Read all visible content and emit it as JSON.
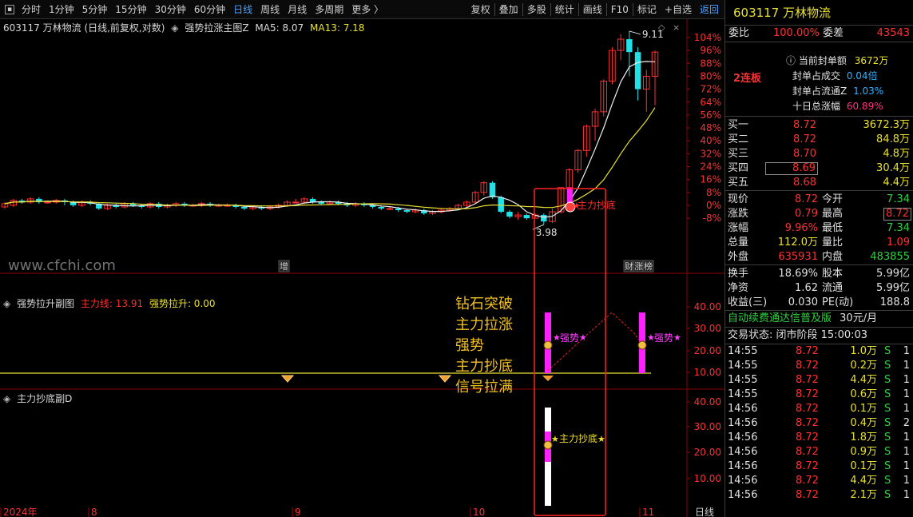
{
  "toolbar": {
    "left_items": [
      "分时",
      "1分钟",
      "5分钟",
      "15分钟",
      "30分钟",
      "60分钟",
      "日线",
      "周线",
      "月线",
      "多周期",
      "更多 〉"
    ],
    "active_index": 6,
    "right_items": [
      "复权",
      "叠加",
      "多股",
      "统计",
      "画线",
      "F10",
      "标记",
      "+自选",
      "返回"
    ]
  },
  "main_info": {
    "title": "603117 万林物流 (日线,前复权,对数)",
    "indicator": "强势拉涨主图Z",
    "ma5": "MA5: 8.07",
    "ma13": "MA13: 7.18",
    "sub1_name": "强势拉升副图",
    "sub1_v1": "主力线: 13.91",
    "sub1_v2": "强势拉升: 0.00",
    "sub2_name": "主力抄底副D",
    "watermark": "www.cfchi.com"
  },
  "chart_data": {
    "type": "candlestick",
    "price_axis_labels": [
      "104%",
      "96%",
      "88%",
      "80%",
      "72%",
      "64%",
      "56%",
      "48%",
      "40%",
      "32%",
      "24%",
      "16%",
      "8%",
      "0%",
      "-8%"
    ],
    "sub1_axis_labels": [
      "40.00",
      "30.00",
      "20.00",
      "10.00"
    ],
    "sub2_axis_labels": [
      "40.00",
      "30.00",
      "20.00",
      "10.00"
    ],
    "date_labels": [
      "2024年",
      "8",
      "9",
      "10",
      "11"
    ],
    "period_label": "日线",
    "high_label": "9.11",
    "low_label": "3.98",
    "marker_labels": [
      "增",
      "财",
      "涨",
      "榜"
    ],
    "signal_main": "主力抄底",
    "signal_strong": "强势",
    "signal_bottom": "主力抄底"
  },
  "annotation": [
    "钻石突破",
    "主力拉涨",
    "强势",
    "主力抄底",
    "信号拉满"
  ],
  "quote": {
    "title": "603117 万林物流",
    "weibi_label": "委比",
    "weibi": "100.00%",
    "weicha_label": "委差",
    "weicha": "43543",
    "lianban": "2连板",
    "seal_amount_label": "当前封单额",
    "seal_amount": "3672万",
    "seal_trade_label": "封单占成交",
    "seal_trade": "0.04倍",
    "seal_float_label": "封单占流通Z",
    "seal_float": "1.03%",
    "ten_day_label": "十日总涨幅",
    "ten_day": "60.89%",
    "bids": [
      {
        "label": "买一",
        "price": "8.72",
        "vol": "3672.3万"
      },
      {
        "label": "买二",
        "price": "8.72",
        "vol": "84.8万"
      },
      {
        "label": "买三",
        "price": "8.70",
        "vol": "4.8万"
      },
      {
        "label": "买四",
        "price": "8.69",
        "vol": "30.4万"
      },
      {
        "label": "买五",
        "price": "8.68",
        "vol": "4.4万"
      }
    ],
    "stats": [
      {
        "l1": "现价",
        "v1": "8.72",
        "c1": "red",
        "l2": "今开",
        "v2": "7.34",
        "c2": "green"
      },
      {
        "l1": "涨跌",
        "v1": "0.79",
        "c1": "red",
        "l2": "最高",
        "v2": "8.72",
        "c2": "red"
      },
      {
        "l1": "涨幅",
        "v1": "9.96%",
        "c1": "red",
        "l2": "最低",
        "v2": "7.34",
        "c2": "green"
      },
      {
        "l1": "总量",
        "v1": "112.0万",
        "c1": "yellow",
        "l2": "量比",
        "v2": "1.09",
        "c2": "red"
      },
      {
        "l1": "外盘",
        "v1": "635931",
        "c1": "red",
        "l2": "内盘",
        "v2": "483855",
        "c2": "green"
      }
    ],
    "fund": [
      {
        "l1": "换手",
        "v1": "18.69%",
        "l2": "股本",
        "v2": "5.99亿"
      },
      {
        "l1": "净资",
        "v1": "1.62",
        "l2": "流通",
        "v2": "5.99亿"
      },
      {
        "l1": "收益(三)",
        "v1": "0.030",
        "l2": "PE(动)",
        "v2": "188.8"
      }
    ],
    "promo": "自动续费通达信普及版",
    "promo_price": "30元/月",
    "status": "交易状态: 闭市阶段 15:00:03",
    "trades": [
      {
        "t": "14:55",
        "p": "8.72",
        "v": "1.0万",
        "s": "S",
        "n": "1"
      },
      {
        "t": "14:55",
        "p": "8.72",
        "v": "0.2万",
        "s": "S",
        "n": "1"
      },
      {
        "t": "14:55",
        "p": "8.72",
        "v": "4.4万",
        "s": "S",
        "n": "1"
      },
      {
        "t": "14:55",
        "p": "8.72",
        "v": "0.6万",
        "s": "S",
        "n": "1"
      },
      {
        "t": "14:56",
        "p": "8.72",
        "v": "0.1万",
        "s": "S",
        "n": "1"
      },
      {
        "t": "14:56",
        "p": "8.72",
        "v": "0.4万",
        "s": "S",
        "n": "2"
      },
      {
        "t": "14:56",
        "p": "8.72",
        "v": "1.8万",
        "s": "S",
        "n": "1"
      },
      {
        "t": "14:56",
        "p": "8.72",
        "v": "0.9万",
        "s": "S",
        "n": "1"
      },
      {
        "t": "14:56",
        "p": "8.72",
        "v": "0.1万",
        "s": "S",
        "n": "1"
      },
      {
        "t": "14:56",
        "p": "8.72",
        "v": "4.4万",
        "s": "S",
        "n": "1"
      },
      {
        "t": "14:56",
        "p": "8.72",
        "v": "2.1万",
        "s": "S",
        "n": "1"
      }
    ]
  }
}
